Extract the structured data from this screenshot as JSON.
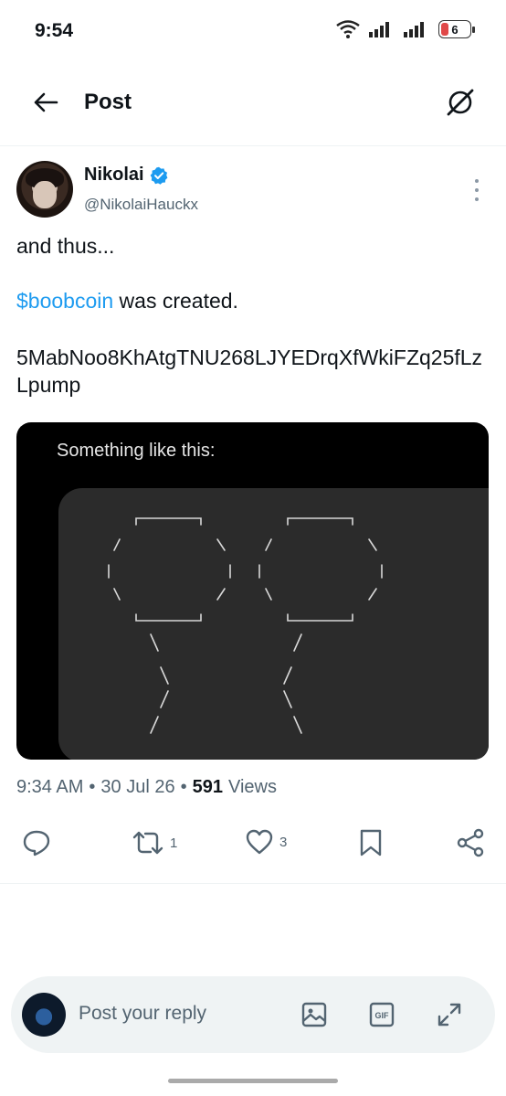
{
  "status_bar": {
    "time": "9:54",
    "battery_level": "6"
  },
  "header": {
    "title": "Post"
  },
  "tweet": {
    "display_name": "Nikolai",
    "handle": "@NikolaiHauckx",
    "verified": true,
    "text_line1": "and thus...",
    "cashtag": "$boobcoin",
    "text_line2_rest": " was created.",
    "text_line3": "5MabNoo8KhAtgTNU268LJYEDrqXfWkiFZq25fLzLpump",
    "media_caption": "Something like this:",
    "time": "9:34 AM",
    "date": "30 Jul 26",
    "views_count": "591",
    "views_label": "Views"
  },
  "actions": {
    "replies": "",
    "reposts": "1",
    "likes": "3"
  },
  "reply": {
    "placeholder": "Post your reply"
  },
  "colors": {
    "accent": "#1d9bf0",
    "secondary_text": "#536471",
    "battery_low": "#e04848"
  },
  "icons": [
    "back-arrow-icon",
    "grok-icon",
    "verified-badge-icon",
    "more-icon",
    "reply-icon",
    "repost-icon",
    "like-icon",
    "bookmark-icon",
    "share-icon",
    "image-icon",
    "gif-icon",
    "expand-icon",
    "wifi-icon",
    "signal-icon"
  ]
}
